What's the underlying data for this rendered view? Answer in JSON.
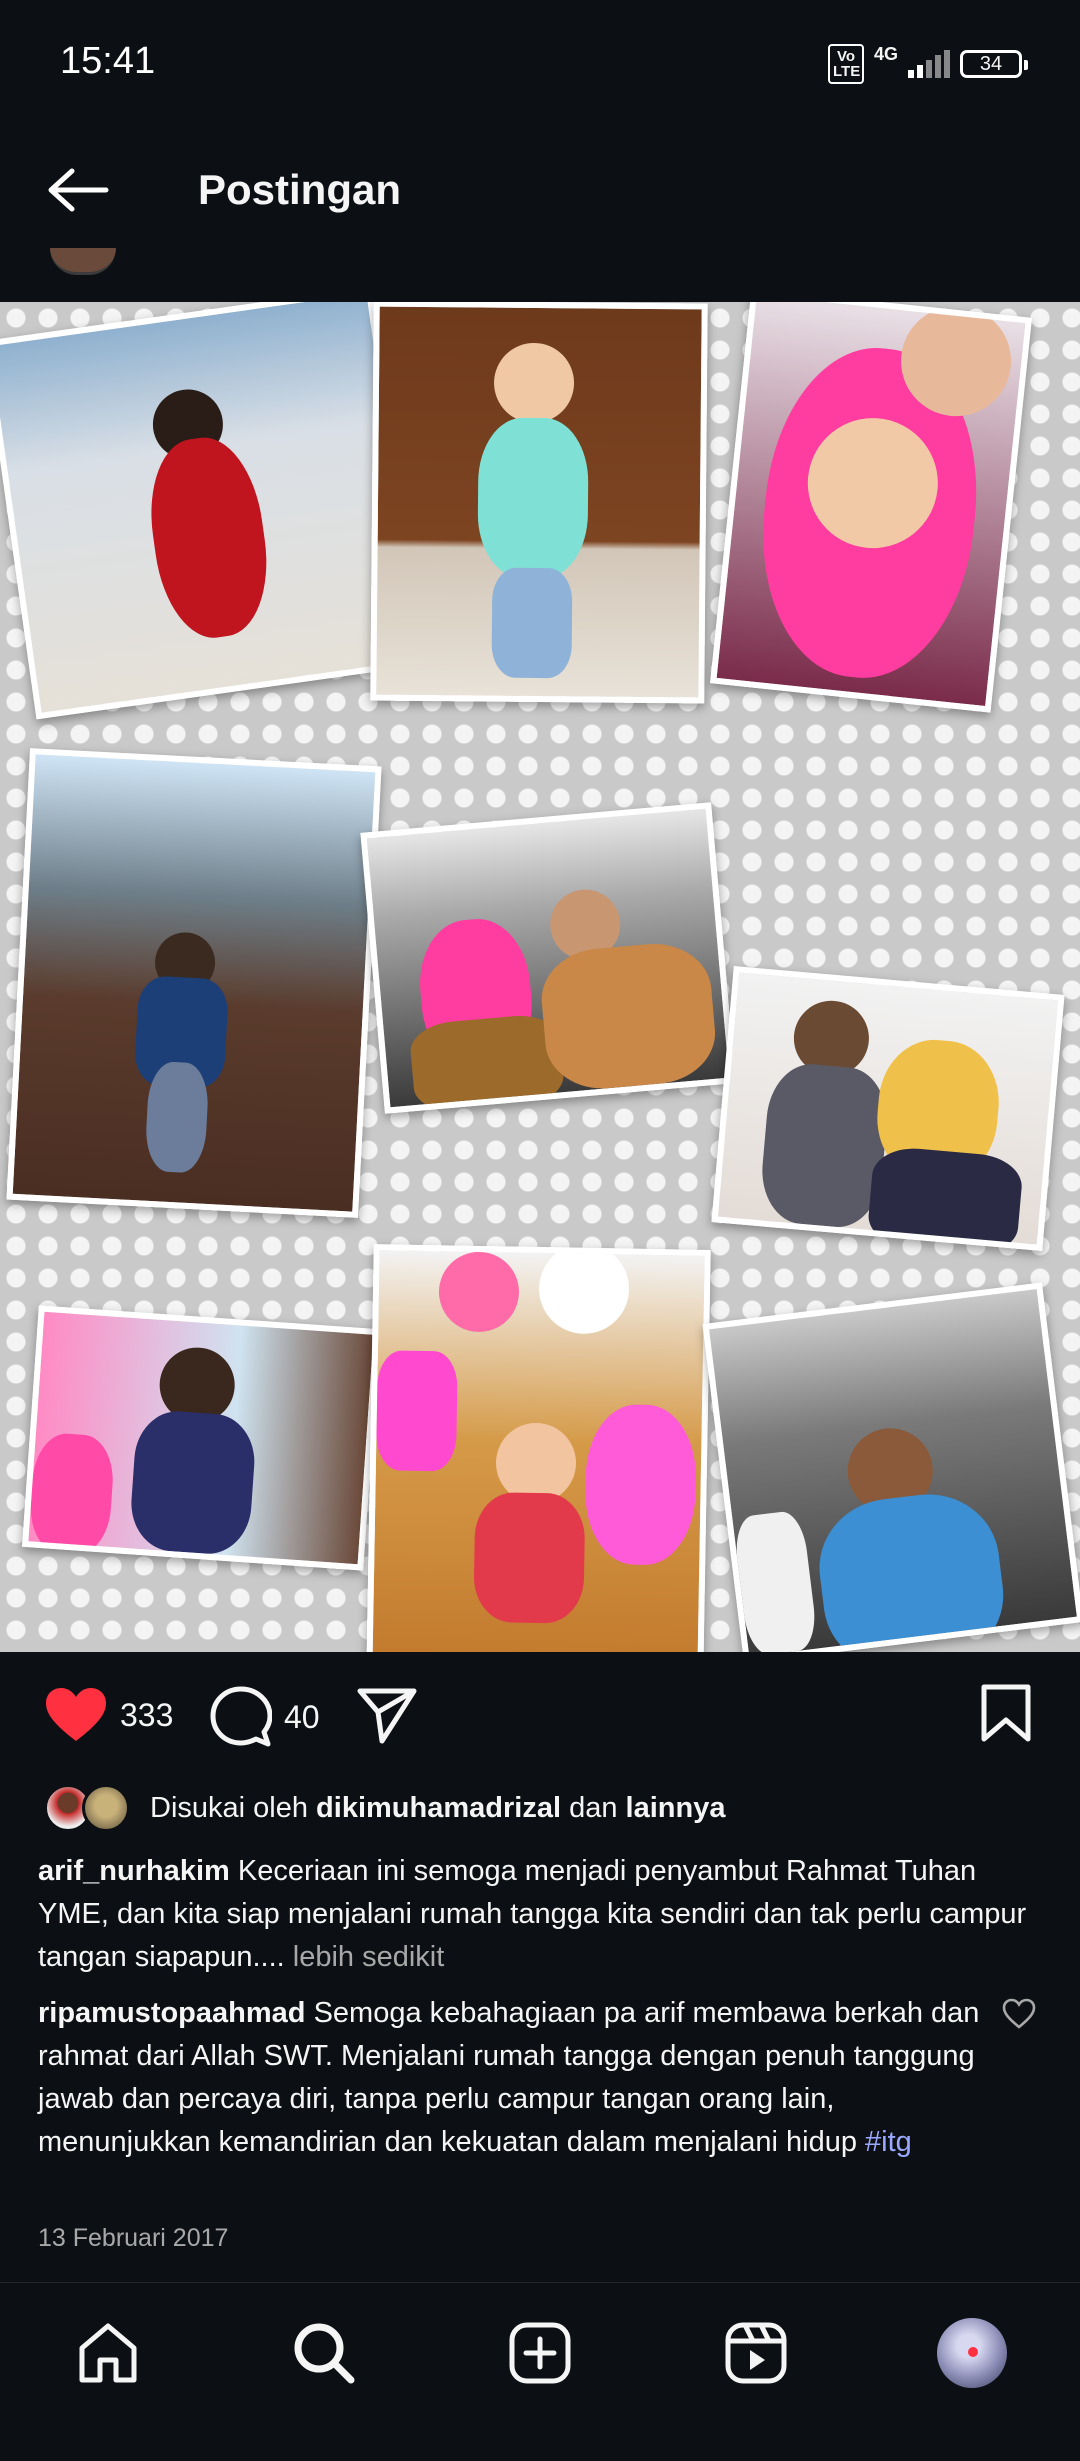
{
  "status_bar": {
    "time": "15:41",
    "volte_label": "Vo LTE",
    "network": "4G",
    "battery": "34",
    "icons": [
      "volte-icon",
      "signal-icon",
      "battery-icon"
    ]
  },
  "header": {
    "title": "Postingan",
    "back_icon": "arrow-left-icon"
  },
  "post": {
    "image_description_icons": [
      "photo-collage"
    ],
    "actions": {
      "like_count": "333",
      "comment_count": "40",
      "liked": true,
      "like_color": "#ff3040"
    },
    "likes": {
      "prefix": "Disukai oleh",
      "user": "dikimuhamadrizal",
      "connector": "dan",
      "others": "lainnya"
    },
    "caption": {
      "username": "arif_nurhakim",
      "text": "Keceriaan ini semoga menjadi penyambut Rahmat Tuhan YME,  dan  kita siap menjalani rumah tangga kita sendiri dan tak perlu campur tangan siapapun....",
      "less_label": "lebih sedikit"
    },
    "comment": {
      "username": "ripamustopaahmad",
      "text": "Semoga kebahagiaan pa arif membawa berkah dan rahmat dari Allah SWT. Menjalani rumah tangga dengan penuh tanggung jawab dan percaya diri, tanpa perlu campur tangan orang lain, menunjukkan kemandirian dan kekuatan dalam menjalani hidup",
      "hashtag": "#itg"
    },
    "date": "13 Februari 2017"
  },
  "bottom_nav": {
    "items": [
      "home-icon",
      "search-icon",
      "create-icon",
      "reels-icon",
      "profile-avatar"
    ],
    "notification_color": "#ff3040"
  },
  "colors": {
    "background": "#0c1014",
    "text": "#f5f5f5",
    "muted": "#a8a8a8",
    "hashtag": "#9aa9ff"
  }
}
